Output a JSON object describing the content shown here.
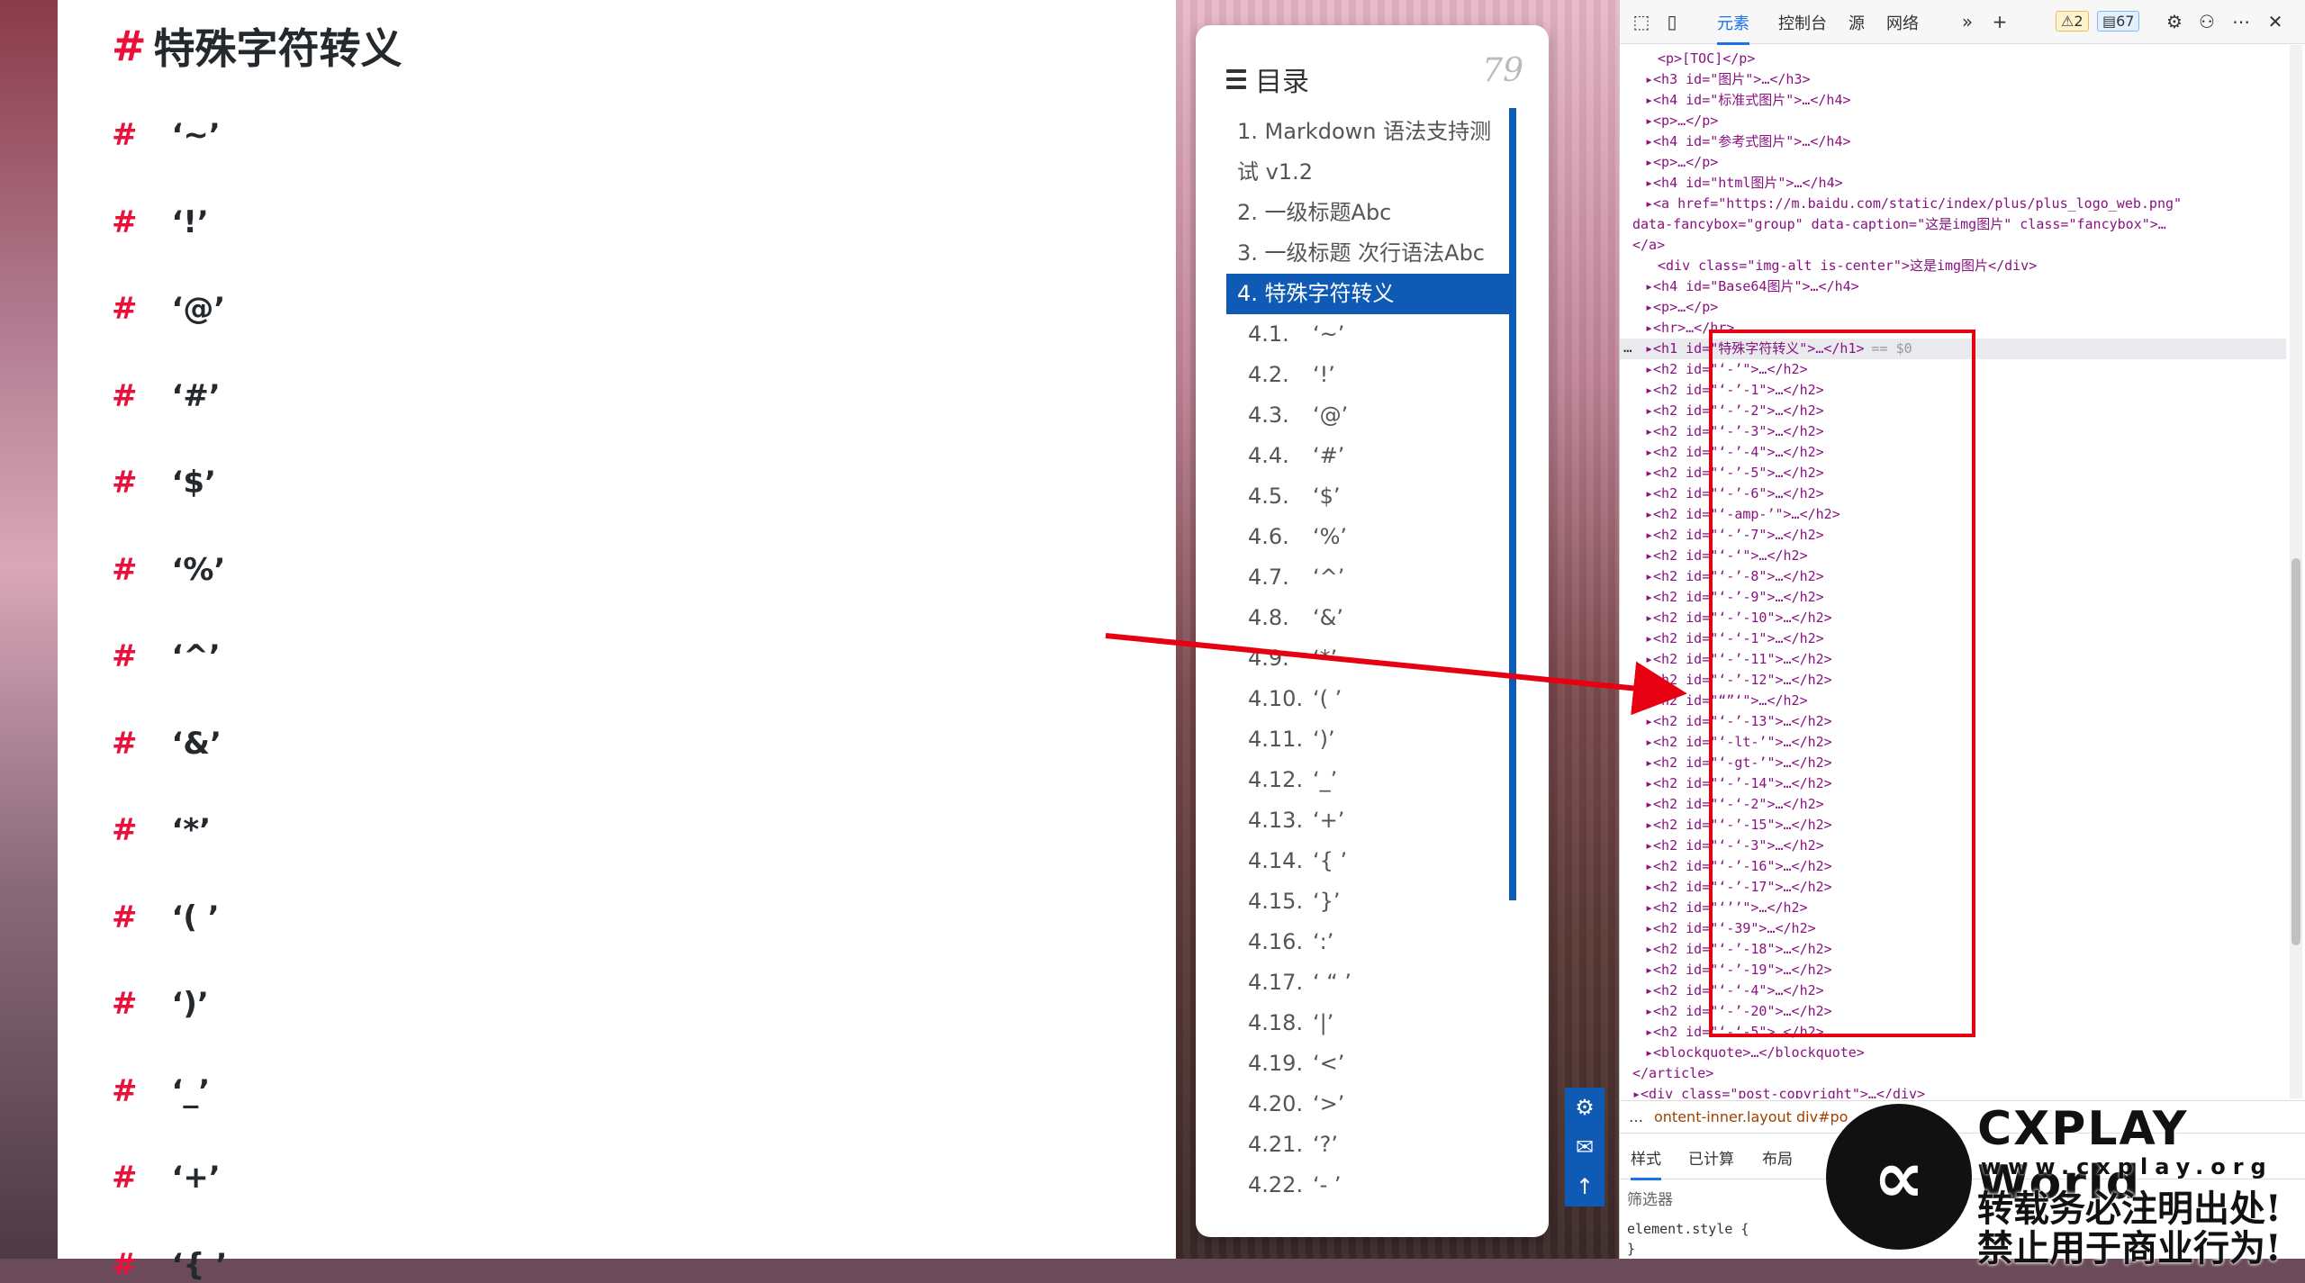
{
  "article": {
    "h1": "特殊字符转义",
    "hash": "#",
    "headings": [
      "‘~’",
      "‘!’",
      "‘@’",
      "‘#’",
      "‘$’",
      "‘%’",
      "‘^’",
      "‘&’",
      "‘*’",
      "‘(  ’",
      "‘)’",
      "‘_’",
      "‘+’",
      "‘{  ’"
    ]
  },
  "toc": {
    "title": "目录",
    "count": "79",
    "items": [
      {
        "label": "1. Markdown 语法支持测试 v1.2",
        "level": 1,
        "active": false
      },
      {
        "label": "2. 一级标题Abc",
        "level": 1,
        "active": false
      },
      {
        "label": "3. 一级标题 次行语法Abc",
        "level": 1,
        "active": false
      },
      {
        "label": "4. 特殊字符转义",
        "level": 1,
        "active": true
      },
      {
        "num": "4.1.",
        "label": "‘~’",
        "level": 2
      },
      {
        "num": "4.2.",
        "label": "‘!’",
        "level": 2
      },
      {
        "num": "4.3.",
        "label": "‘@’",
        "level": 2
      },
      {
        "num": "4.4.",
        "label": "‘#’",
        "level": 2
      },
      {
        "num": "4.5.",
        "label": "‘$’",
        "level": 2
      },
      {
        "num": "4.6.",
        "label": "‘%’",
        "level": 2
      },
      {
        "num": "4.7.",
        "label": "‘^’",
        "level": 2
      },
      {
        "num": "4.8.",
        "label": "‘&’",
        "level": 2
      },
      {
        "num": "4.9.",
        "label": "‘*’",
        "level": 2
      },
      {
        "num": "4.10.",
        "label": "‘(  ’",
        "level": 2
      },
      {
        "num": "4.11.",
        "label": "‘)’",
        "level": 2
      },
      {
        "num": "4.12.",
        "label": "‘_’",
        "level": 2
      },
      {
        "num": "4.13.",
        "label": "‘+’",
        "level": 2
      },
      {
        "num": "4.14.",
        "label": "‘{  ’",
        "level": 2
      },
      {
        "num": "4.15.",
        "label": "‘}’",
        "level": 2
      },
      {
        "num": "4.16.",
        "label": "‘:’",
        "level": 2
      },
      {
        "num": "4.17.",
        "label": "‘ “  ’",
        "level": 2
      },
      {
        "num": "4.18.",
        "label": "‘|’",
        "level": 2
      },
      {
        "num": "4.19.",
        "label": "‘<’",
        "level": 2
      },
      {
        "num": "4.20.",
        "label": "‘>’",
        "level": 2
      },
      {
        "num": "4.21.",
        "label": "‘?’",
        "level": 2
      },
      {
        "num": "4.22.",
        "label": "‘-  ’",
        "level": 2
      }
    ]
  },
  "devtools": {
    "tabs": [
      "元素",
      "控制台",
      "源",
      "网络"
    ],
    "warn_count": "2",
    "msg_count": "67",
    "more": "»",
    "add": "+",
    "settings": "⚙",
    "menu": "⋯",
    "close": "✕",
    "selected_marker": "== $0",
    "code_lines": [
      {
        "i": 2,
        "t": "<p>[TOC]</p>"
      },
      {
        "i": 1,
        "t": "▸<h3 id=\"图片\">…</h3>"
      },
      {
        "i": 1,
        "t": "▸<h4 id=\"标准式图片\">…</h4>"
      },
      {
        "i": 1,
        "t": "▸<p>…</p>"
      },
      {
        "i": 1,
        "t": "▸<h4 id=\"参考式图片\">…</h4>"
      },
      {
        "i": 1,
        "t": "▸<p>…</p>"
      },
      {
        "i": 1,
        "t": "▸<h4 id=\"html图片\">…</h4>"
      },
      {
        "i": 1,
        "t": "▸<a href=\"https://m.baidu.com/static/index/plus/plus_logo_web.png\""
      },
      {
        "i": 0,
        "t": "data-fancybox=\"group\" data-caption=\"这是img图片\" class=\"fancybox\">…"
      },
      {
        "i": 0,
        "t": "</a>"
      },
      {
        "i": 2,
        "t": "<div class=\"img-alt is-center\">这是img图片</div>"
      },
      {
        "i": 1,
        "t": "▸<h4 id=\"Base64图片\">…</h4>"
      },
      {
        "i": 1,
        "t": "▸<p>…</p>"
      },
      {
        "i": 1,
        "t": "▸<hr>…</hr>"
      },
      {
        "i": 1,
        "t": "▸<h1 id=\"特殊字符转义\">…</h1>",
        "sel": true
      },
      {
        "i": 1,
        "t": "▸<h2 id=\"‘-’\">…</h2>"
      },
      {
        "i": 1,
        "t": "▸<h2 id=\"‘-’-1\">…</h2>"
      },
      {
        "i": 1,
        "t": "▸<h2 id=\"‘-’-2\">…</h2>"
      },
      {
        "i": 1,
        "t": "▸<h2 id=\"‘-’-3\">…</h2>"
      },
      {
        "i": 1,
        "t": "▸<h2 id=\"‘-’-4\">…</h2>"
      },
      {
        "i": 1,
        "t": "▸<h2 id=\"‘-’-5\">…</h2>"
      },
      {
        "i": 1,
        "t": "▸<h2 id=\"‘-’-6\">…</h2>"
      },
      {
        "i": 1,
        "t": "▸<h2 id=\"‘-amp-’\">…</h2>"
      },
      {
        "i": 1,
        "t": "▸<h2 id=\"‘-’-7\">…</h2>"
      },
      {
        "i": 1,
        "t": "▸<h2 id=\"‘-‘\">…</h2>"
      },
      {
        "i": 1,
        "t": "▸<h2 id=\"‘-’-8\">…</h2>"
      },
      {
        "i": 1,
        "t": "▸<h2 id=\"‘-’-9\">…</h2>"
      },
      {
        "i": 1,
        "t": "▸<h2 id=\"‘-’-10\">…</h2>"
      },
      {
        "i": 1,
        "t": "▸<h2 id=\"‘-‘-1\">…</h2>"
      },
      {
        "i": 1,
        "t": "▸<h2 id=\"‘-’-11\">…</h2>"
      },
      {
        "i": 1,
        "t": "▸<h2 id=\"‘-’-12\">…</h2>"
      },
      {
        "i": 1,
        "t": "▸<h2 id=\"“”‘\">…</h2>"
      },
      {
        "i": 1,
        "t": "▸<h2 id=\"‘-’-13\">…</h2>"
      },
      {
        "i": 1,
        "t": "▸<h2 id=\"‘-lt-’\">…</h2>"
      },
      {
        "i": 1,
        "t": "▸<h2 id=\"‘-gt-’\">…</h2>"
      },
      {
        "i": 1,
        "t": "▸<h2 id=\"‘-’-14\">…</h2>"
      },
      {
        "i": 1,
        "t": "▸<h2 id=\"‘-‘-2\">…</h2>"
      },
      {
        "i": 1,
        "t": "▸<h2 id=\"‘-’-15\">…</h2>"
      },
      {
        "i": 1,
        "t": "▸<h2 id=\"‘-‘-3\">…</h2>"
      },
      {
        "i": 1,
        "t": "▸<h2 id=\"‘-’-16\">…</h2>"
      },
      {
        "i": 1,
        "t": "▸<h2 id=\"‘-’-17\">…</h2>"
      },
      {
        "i": 1,
        "t": "▸<h2 id=\"‘’’\">…</h2>"
      },
      {
        "i": 1,
        "t": "▸<h2 id=\"‘-39\">…</h2>"
      },
      {
        "i": 1,
        "t": "▸<h2 id=\"‘-’-18\">…</h2>"
      },
      {
        "i": 1,
        "t": "▸<h2 id=\"‘-’-19\">…</h2>"
      },
      {
        "i": 1,
        "t": "▸<h2 id=\"‘-‘-4\">…</h2>"
      },
      {
        "i": 1,
        "t": "▸<h2 id=\"‘-’-20\">…</h2>"
      },
      {
        "i": 1,
        "t": "▸<h2 id=\"‘-‘-5\">…</h2>"
      },
      {
        "i": 1,
        "t": "▸<blockquote>…</blockquote>"
      },
      {
        "i": 0,
        "t": "</article>"
      },
      {
        "i": 0,
        "t": "▸<div class=\"post-copyright\">…</div>"
      }
    ],
    "breadcrumb": [
      "…",
      "ontent-inner.layout",
      "div#po"
    ],
    "style_tabs": [
      "样式",
      "已计算",
      "布局"
    ],
    "filter_placeholder": "筛选器",
    "element_style": "element.style {",
    "element_style_close": "}"
  },
  "watermark": {
    "logo": "∝",
    "title": "CXPLAY World",
    "url": "www.cxplay.org",
    "line1": "转载务必注明出处!",
    "line2": "禁止用于商业行为!"
  },
  "colors": {
    "accent": "#0e5ab4",
    "hash": "#e8113a",
    "annotation": "#e60012"
  }
}
